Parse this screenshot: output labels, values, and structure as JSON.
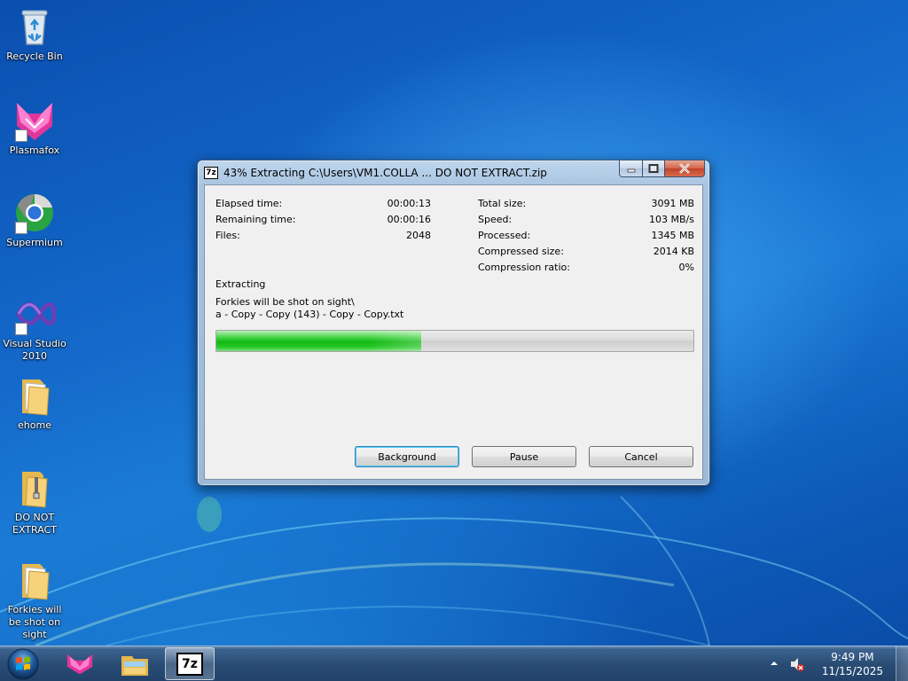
{
  "desktop": {
    "icons": [
      {
        "label": "Recycle Bin",
        "icon": "recycle-bin-icon"
      },
      {
        "label": "Plasmafox",
        "icon": "plasmafox-icon"
      },
      {
        "label": "Supermium",
        "icon": "supermium-icon"
      },
      {
        "label": "Visual Studio 2010",
        "icon": "visual-studio-icon"
      },
      {
        "label": "ehome",
        "icon": "folder-icon"
      },
      {
        "label": "DO NOT EXTRACT",
        "icon": "zip-folder-icon"
      },
      {
        "label": "Forkies will be shot on sight",
        "icon": "folder-icon"
      }
    ]
  },
  "window": {
    "app_icon_text": "7z",
    "title": "43% Extracting C:\\Users\\VM1.COLLA ... DO NOT EXTRACT.zip",
    "left_stats": [
      {
        "label": "Elapsed time:",
        "value": "00:00:13"
      },
      {
        "label": "Remaining time:",
        "value": "00:00:16"
      },
      {
        "label": "Files:",
        "value": "2048"
      }
    ],
    "right_stats": [
      {
        "label": "Total size:",
        "value": "3091 MB"
      },
      {
        "label": "Speed:",
        "value": "103 MB/s"
      },
      {
        "label": "Processed:",
        "value": "1345 MB"
      },
      {
        "label": "Compressed size:",
        "value": "2014 KB"
      },
      {
        "label": "Compression ratio:",
        "value": "0%"
      }
    ],
    "status": "Extracting",
    "current_folder": "Forkies will be shot on sight\\",
    "current_file": "a - Copy - Copy (143) - Copy - Copy.txt",
    "progress_percent": 43,
    "buttons": {
      "background": "Background",
      "pause": "Pause",
      "cancel": "Cancel"
    }
  },
  "taskbar": {
    "time": "9:49 PM",
    "date": "11/15/2025",
    "pinned": [
      "plasmafox-icon",
      "explorer-icon",
      "7zip-icon"
    ],
    "seven_zip_text": "7z"
  },
  "colors": {
    "progress_green": "#13b913",
    "desktop_blue": "#1367c8"
  }
}
